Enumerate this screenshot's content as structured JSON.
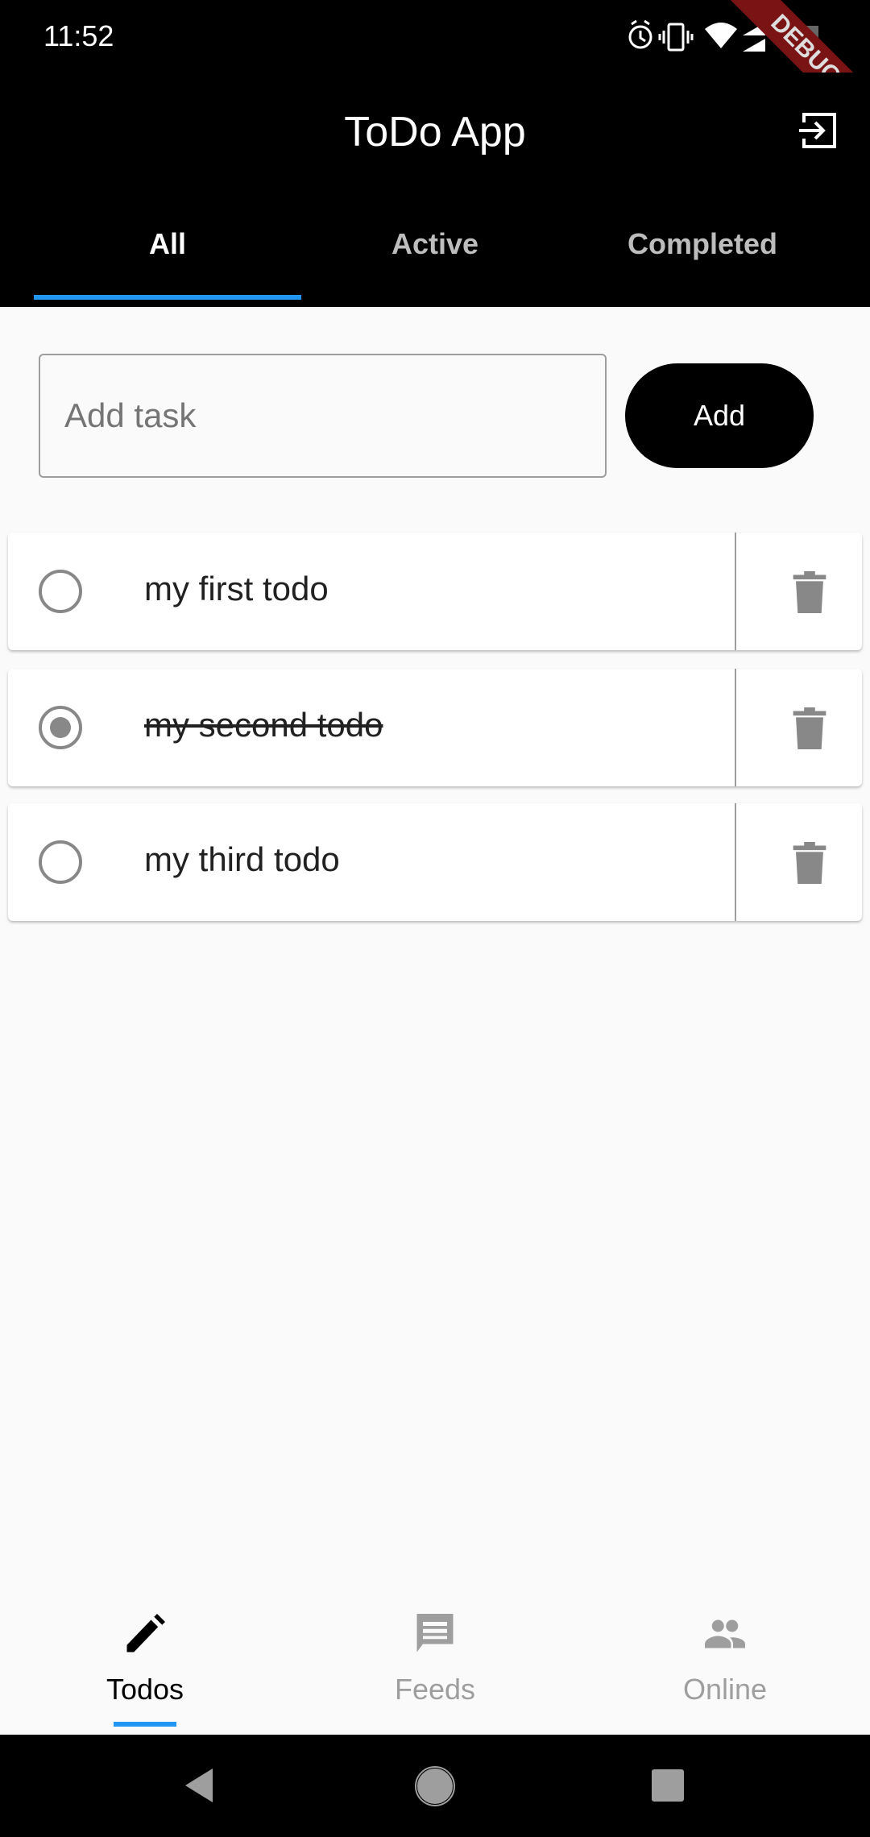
{
  "status_bar": {
    "time": "11:52",
    "icons": [
      "alarm-icon",
      "vibrate-icon",
      "wifi-icon",
      "signal-icon",
      "battery-icon"
    ]
  },
  "debug_banner": "DEBUG",
  "app_bar": {
    "title": "ToDo App",
    "action_icon": "logout-icon"
  },
  "tabs": [
    {
      "label": "All",
      "selected": true
    },
    {
      "label": "Active",
      "selected": false
    },
    {
      "label": "Completed",
      "selected": false
    }
  ],
  "add_form": {
    "placeholder": "Add task",
    "value": "",
    "button_label": "Add"
  },
  "todos": [
    {
      "text": "my first todo",
      "completed": false
    },
    {
      "text": "my second todo",
      "completed": true
    },
    {
      "text": "my third todo",
      "completed": false
    }
  ],
  "bottom_nav": [
    {
      "label": "Todos",
      "icon": "pencil-icon",
      "selected": true
    },
    {
      "label": "Feeds",
      "icon": "chat-icon",
      "selected": false
    },
    {
      "label": "Online",
      "icon": "people-icon",
      "selected": false
    }
  ],
  "colors": {
    "accent": "#2196f3",
    "appbar": "#000000",
    "debug": "#7a1414"
  }
}
